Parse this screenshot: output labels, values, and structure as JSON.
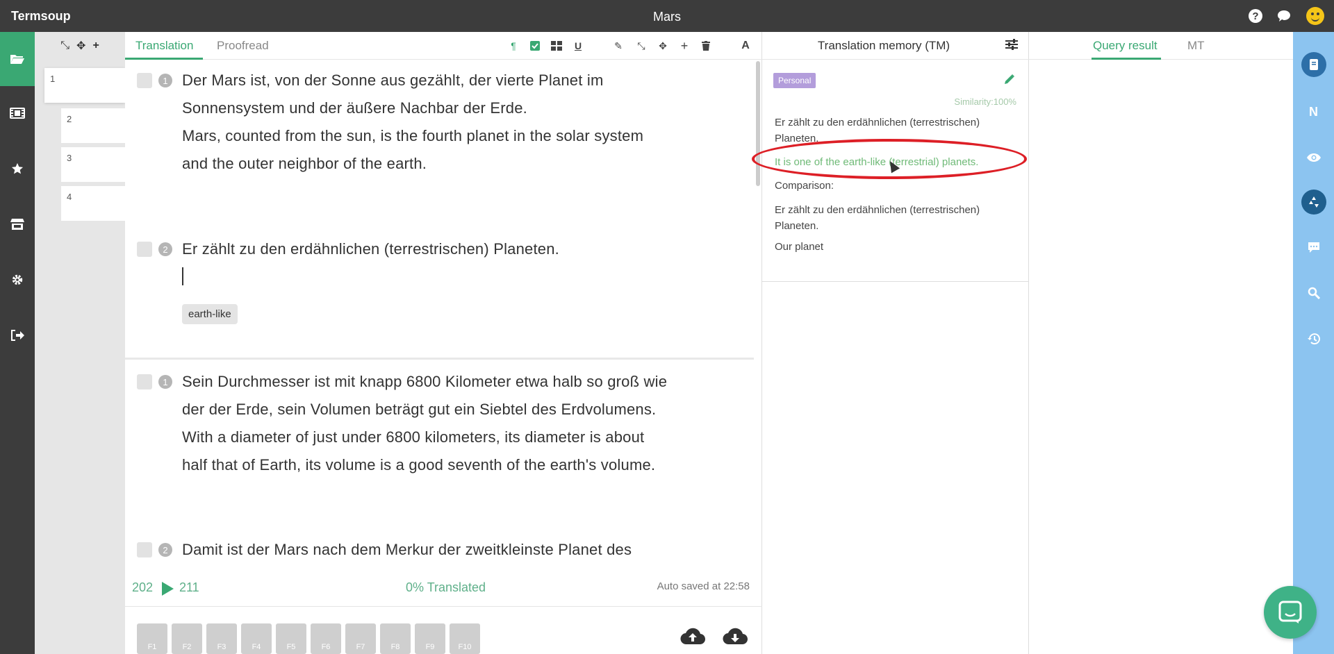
{
  "app": {
    "name": "Termsoup",
    "document_title": "Mars"
  },
  "titlebar": {
    "icons": [
      "help-icon",
      "chat-icon",
      "smiley-avatar-icon"
    ]
  },
  "left_sidebar": {
    "items": [
      "folder-open-icon",
      "film-icon",
      "star-icon",
      "store-icon",
      "gear-icon",
      "sign-out-icon"
    ],
    "active": "folder-open-icon"
  },
  "segment_navigator": {
    "segments": [
      "1",
      "2",
      "3",
      "4"
    ],
    "active": "1"
  },
  "editor": {
    "tabs": [
      "Translation",
      "Proofread"
    ],
    "active_tab": "Translation",
    "toolbar_icons": [
      "paragraph-icon",
      "checkbox-icon",
      "grid-icon",
      "underline-icon",
      "pencil-icon",
      "compress-icon",
      "move-icon",
      "plus-icon",
      "trash-icon",
      "font-icon"
    ],
    "paragraphs": [
      {
        "sentences": [
          {
            "number": "1",
            "source_lines": [
              "Der Mars ist, von der Sonne aus gezählt, der vierte Planet im",
              "Sonnensystem und der äußere Nachbar der Erde."
            ],
            "target_lines": [
              "Mars, counted from the sun, is the fourth planet in the solar system",
              "and the outer neighbor of the earth."
            ]
          },
          {
            "number": "2",
            "source_lines": [
              "Er zählt zu den erdähnlichen (terrestrischen) Planeten."
            ],
            "target_lines": [],
            "term_tag": "earth-like"
          }
        ]
      },
      {
        "sentences": [
          {
            "number": "1",
            "source_lines": [
              "Sein Durchmesser ist mit knapp 6800 Kilometer etwa halb so groß wie",
              "der der Erde, sein Volumen beträgt gut ein Siebtel des Erdvolumens."
            ],
            "target_lines": [
              "With a diameter of just under 6800 kilometers, its diameter is about",
              "half that of Earth, its volume is a good seventh of the earth's volume."
            ]
          },
          {
            "number": "2",
            "source_lines": [
              "Damit ist der Mars nach dem Merkur der zweitkleinste Planet des"
            ],
            "target_lines": []
          }
        ]
      }
    ],
    "status": {
      "from": "202",
      "to": "211",
      "translated": "0% Translated",
      "autosave": "Auto saved at 22:58"
    },
    "function_keys": [
      "F1",
      "F2",
      "F3",
      "F4",
      "F5",
      "F6",
      "F7",
      "F8",
      "F9",
      "F10"
    ],
    "bottom_icons": [
      "cloud-upload-icon",
      "cloud-download-icon"
    ]
  },
  "tm_panel": {
    "title": "Translation memory (TM)",
    "badge": "Personal",
    "similarity": "Similarity:100%",
    "source_lines": [
      "Er zählt zu den erdähnlichen (terrestrischen)",
      "Planeten."
    ],
    "target": "It is one of the earth-like (terrestrial) planets.",
    "comparison_label": "Comparison:",
    "comparison_lines": [
      "Er zählt zu den erdähnlichen (terrestrischen)",
      "Planeten."
    ],
    "note": "Our planet"
  },
  "query_panel": {
    "tabs": [
      "Query result",
      "MT"
    ],
    "active_tab": "Query result"
  },
  "right_sidebar": {
    "items": [
      "book-icon",
      "n-icon",
      "eye-icon",
      "recycle-icon",
      "comment-icon",
      "search-icon",
      "history-icon"
    ],
    "active": "recycle-icon"
  },
  "colors": {
    "accent": "#3aa873",
    "titlebar": "#3c3c3c",
    "right_bar": "#8cc4f0",
    "annotation": "#dd1f26",
    "badge": "#b39ddb"
  }
}
